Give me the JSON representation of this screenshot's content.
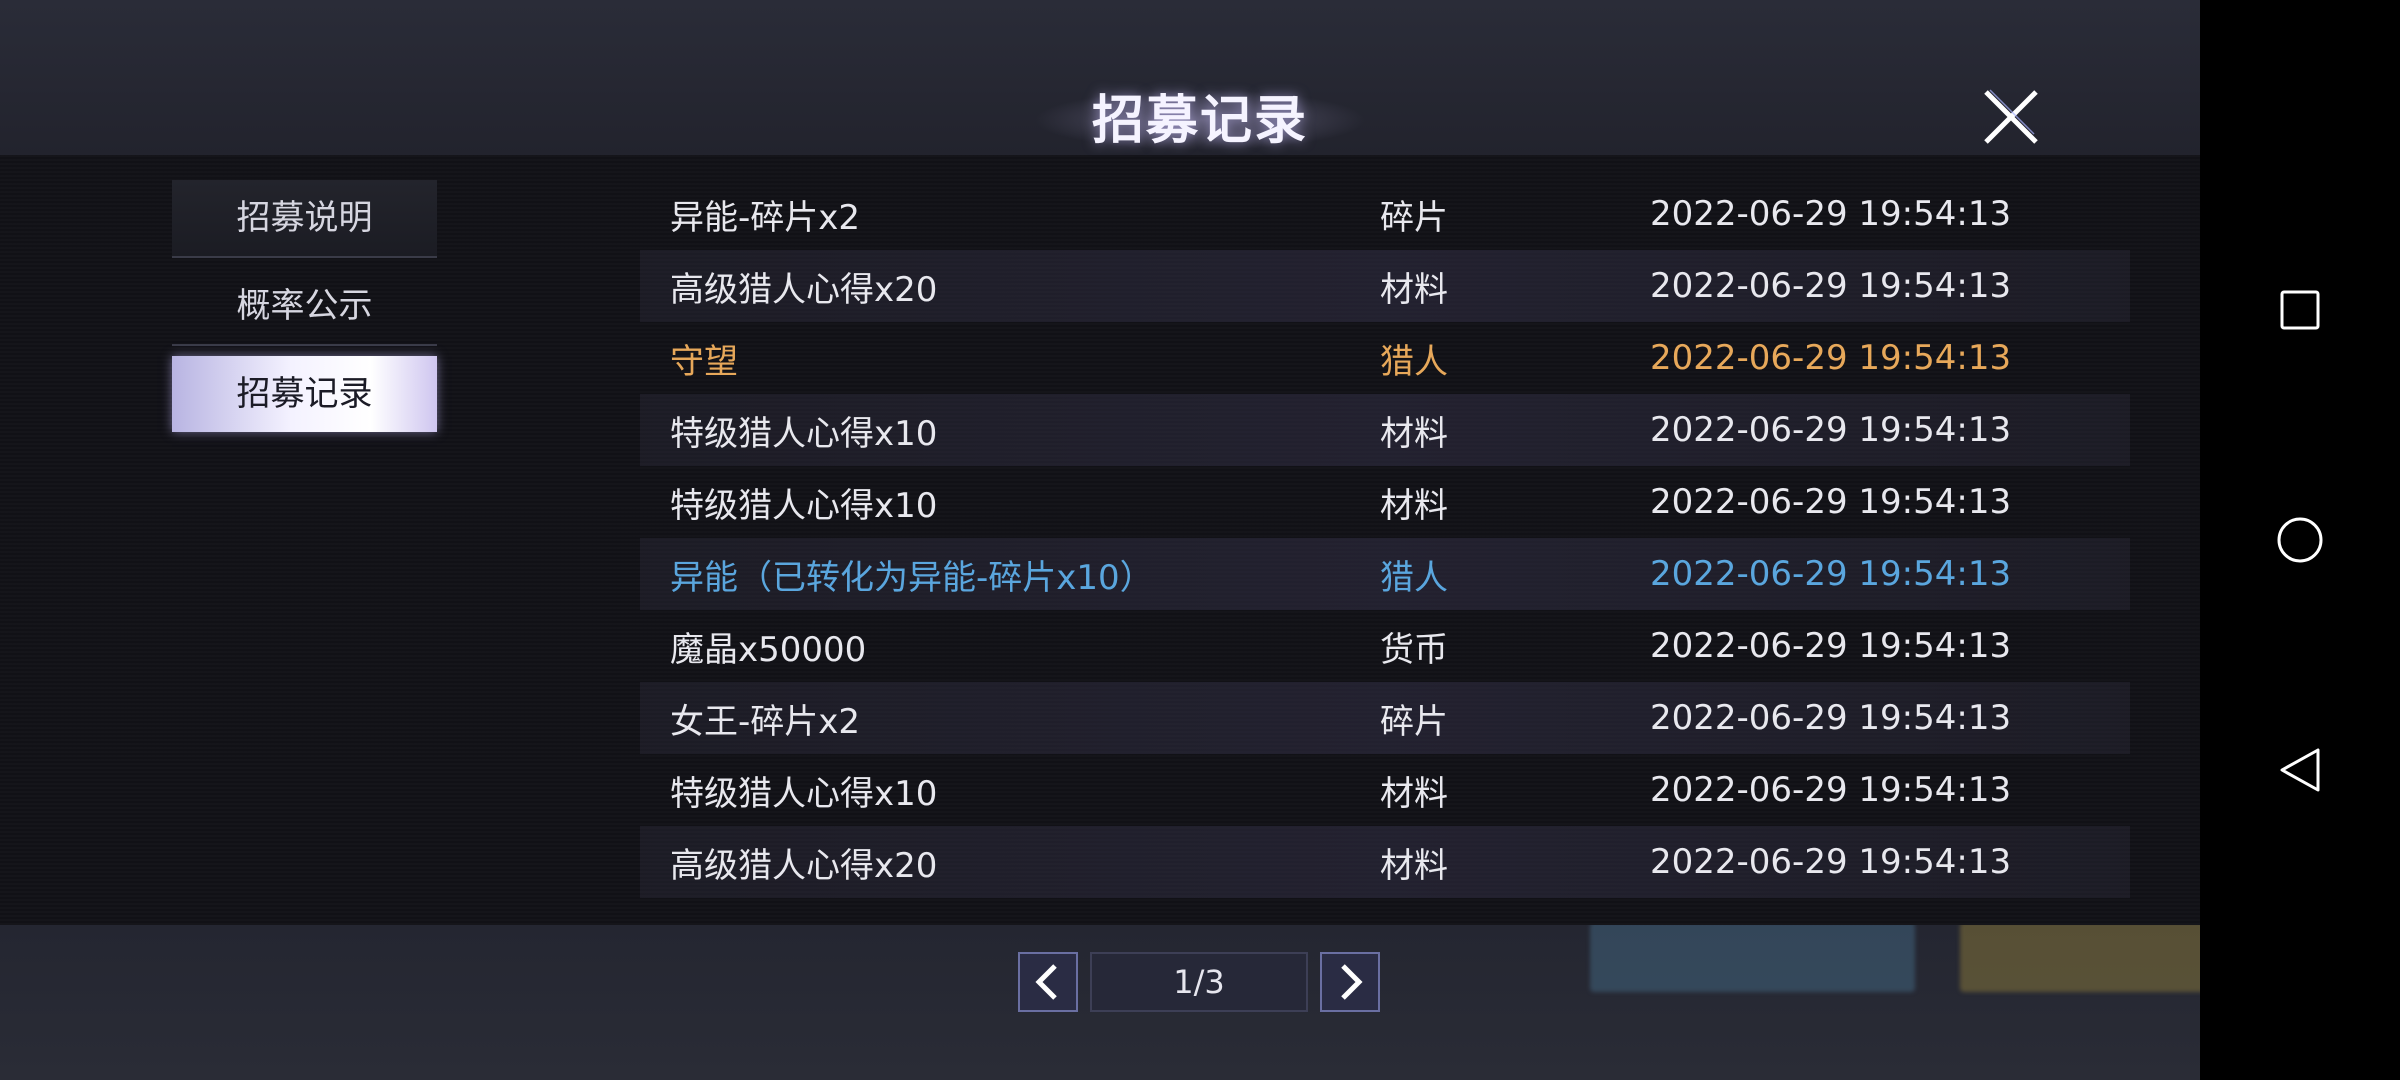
{
  "header": {
    "title": "招募记录"
  },
  "tabs": [
    {
      "label": "招募说明"
    },
    {
      "label": "概率公示"
    },
    {
      "label": "招募记录"
    }
  ],
  "records": [
    {
      "name": "异能-碎片x2",
      "type": "碎片",
      "time": "2022-06-29 19:54:13"
    },
    {
      "name": "高级猎人心得x20",
      "type": "材料",
      "time": "2022-06-29 19:54:13"
    },
    {
      "name": "守望",
      "type": "猎人",
      "time": "2022-06-29 19:54:13"
    },
    {
      "name": "特级猎人心得x10",
      "type": "材料",
      "time": "2022-06-29 19:54:13"
    },
    {
      "name": "特级猎人心得x10",
      "type": "材料",
      "time": "2022-06-29 19:54:13"
    },
    {
      "name": "异能（已转化为异能-碎片x10）",
      "type": "猎人",
      "time": "2022-06-29 19:54:13"
    },
    {
      "name": "魔晶x50000",
      "type": "货币",
      "time": "2022-06-29 19:54:13"
    },
    {
      "name": "女王-碎片x2",
      "type": "碎片",
      "time": "2022-06-29 19:54:13"
    },
    {
      "name": "特级猎人心得x10",
      "type": "材料",
      "time": "2022-06-29 19:54:13"
    },
    {
      "name": "高级猎人心得x20",
      "type": "材料",
      "time": "2022-06-29 19:54:13"
    }
  ],
  "pager": {
    "label": "1/3"
  },
  "colors": {
    "gold": "#e7a85a",
    "blue": "#5aa6de",
    "text": "#e8e8ee"
  },
  "icons": {
    "close": "close-icon",
    "prev": "chevron-left-icon",
    "next": "chevron-right-icon"
  }
}
